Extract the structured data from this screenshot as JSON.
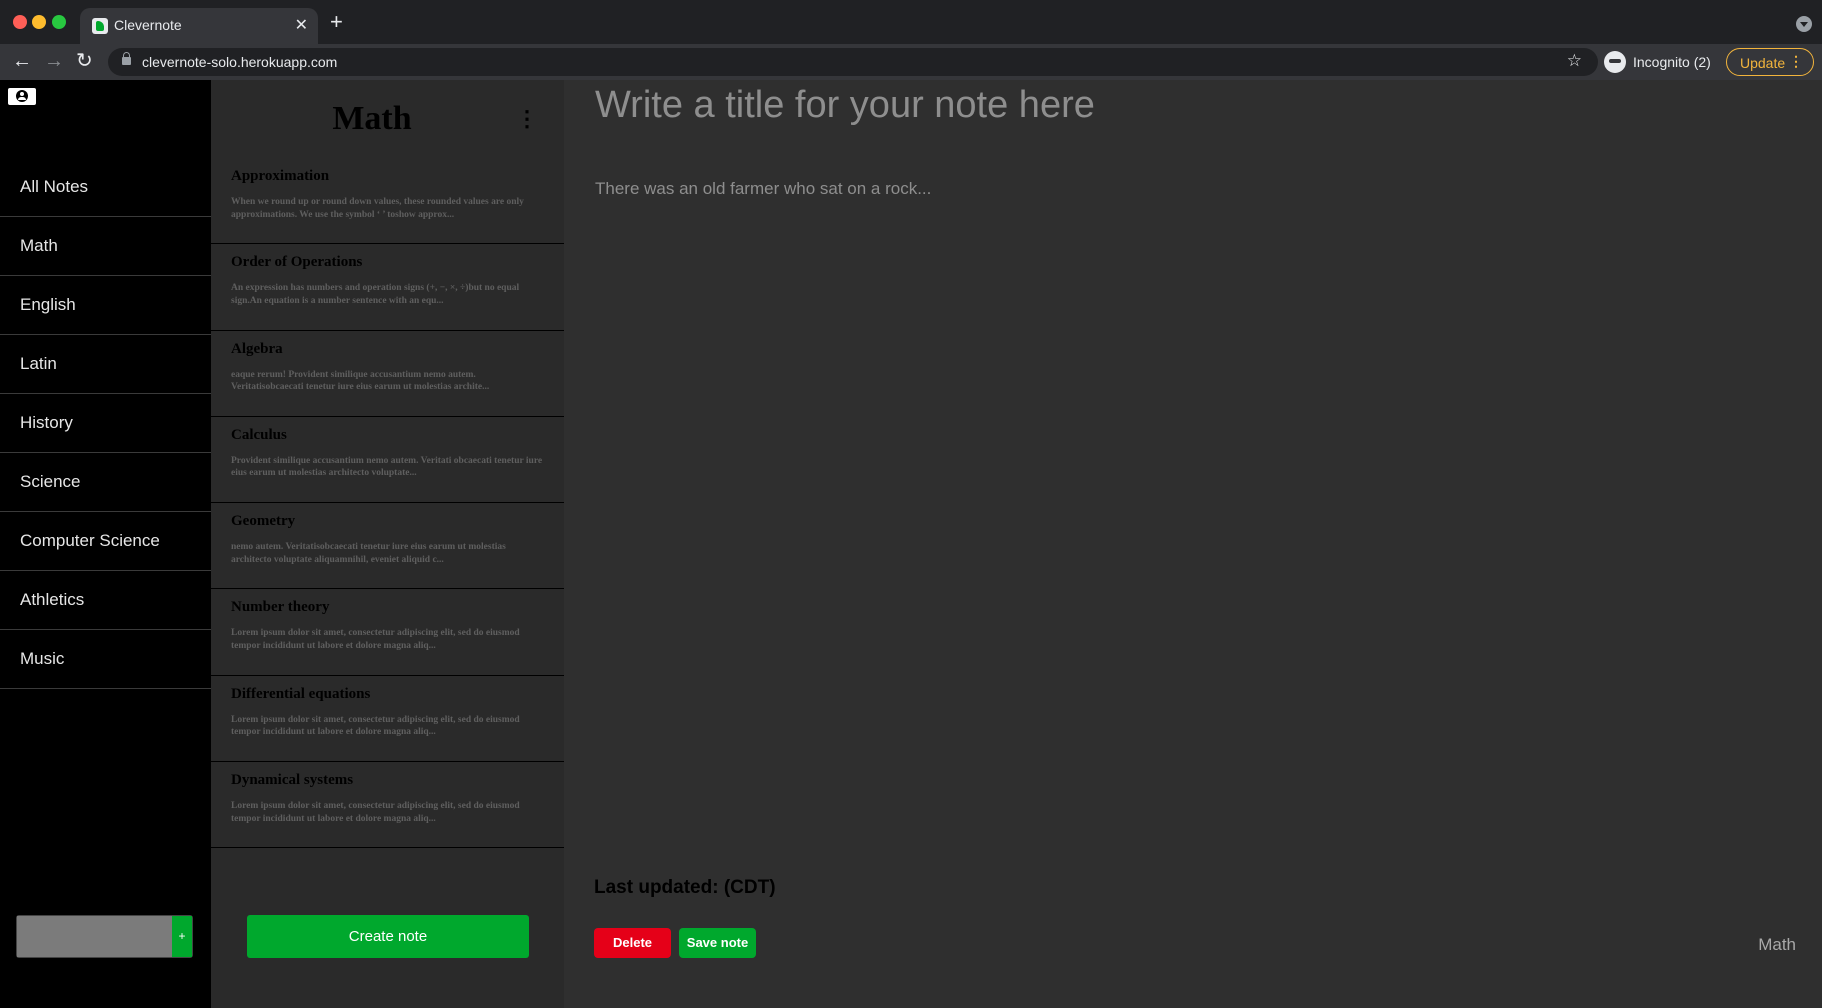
{
  "browser": {
    "tab_title": "Clevernote",
    "tab_close": "✕",
    "new_tab": "+",
    "url": "clevernote-solo.herokuapp.com",
    "incognito_label": "Incognito (2)",
    "update_label": "Update",
    "update_menu": "⋮"
  },
  "sidebar": {
    "notebooks": [
      {
        "label": "All Notes"
      },
      {
        "label": "Math"
      },
      {
        "label": "English"
      },
      {
        "label": "Latin"
      },
      {
        "label": "History"
      },
      {
        "label": "Science"
      },
      {
        "label": "Computer Science"
      },
      {
        "label": "Athletics"
      },
      {
        "label": "Music"
      }
    ],
    "add_button": "+"
  },
  "notes_panel": {
    "title": "Math",
    "menu_icon": "⋮",
    "notes": [
      {
        "title": "Approximation",
        "snippet": "When we round up or round down values, these rounded values are only approximations. We use the symbol ‘ ’ toshow approx..."
      },
      {
        "title": "Order of Operations",
        "snippet": "An expression has numbers and operation signs (+, −, ×, ÷)but no equal sign.An equation is a number sentence with an equ..."
      },
      {
        "title": "Algebra",
        "snippet": "eaque rerum! Provident similique accusantium nemo autem. Veritatisobcaecati tenetur iure eius earum ut molestias archite..."
      },
      {
        "title": "Calculus",
        "snippet": "Provident similique accusantium nemo autem. Veritati obcaecati tenetur iure eius earum ut molestias architecto voluptate..."
      },
      {
        "title": "Geometry",
        "snippet": "nemo autem. Veritatisobcaecati tenetur iure eius earum ut molestias architecto voluptate aliquamnihil, eveniet aliquid c..."
      },
      {
        "title": "Number theory",
        "snippet": "Lorem ipsum dolor sit amet, consectetur adipiscing elit, sed do eiusmod tempor incididunt ut labore et dolore magna aliq..."
      },
      {
        "title": "Differential equations",
        "snippet": "Lorem ipsum dolor sit amet, consectetur adipiscing elit, sed do eiusmod tempor incididunt ut labore et dolore magna aliq..."
      },
      {
        "title": "Dynamical systems",
        "snippet": "Lorem ipsum dolor sit amet, consectetur adipiscing elit, sed do eiusmod tempor incididunt ut labore et dolore magna aliq..."
      }
    ],
    "create_label": "Create note"
  },
  "editor": {
    "title_placeholder": "Write a title for your note here",
    "body_placeholder": "There was an old farmer who sat on a rock...",
    "last_updated": "Last updated: (CDT)",
    "delete_label": "Delete",
    "save_label": "Save note",
    "notebook_tag": "Math"
  },
  "colors": {
    "brand_green": "#00a82d",
    "delete_red": "#e50018",
    "update_accent": "#f2b43c"
  }
}
